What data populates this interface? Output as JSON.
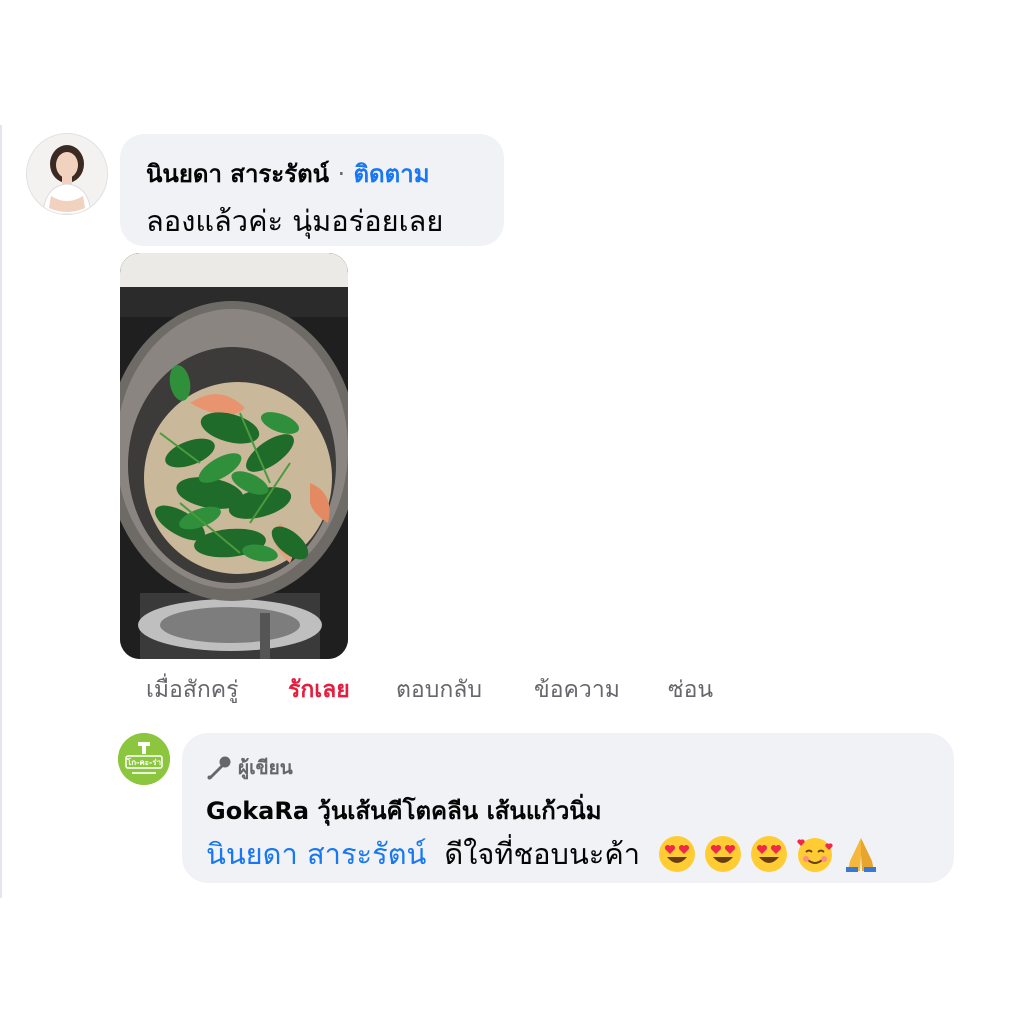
{
  "comment1": {
    "author": "นินยดา สาระรัตน์",
    "separator": "·",
    "follow_label": "ติดตาม",
    "text": "ลองแล้วค่ะ นุ่มอร่อยเลย",
    "timestamp": "เมื่อสักครู่",
    "actions": {
      "love": "รักเลย",
      "reply": "ตอบกลับ",
      "message": "ข้อความ",
      "hide": "ซ่อน"
    }
  },
  "comment2": {
    "badge": "ผู้เขียน",
    "author": "GokaRa วุ้นเส้นคีโตคลีน เส้นแก้วนิ่ม",
    "mention": "นินยดา สาระรัตน์",
    "text": "ดีใจที่ชอบนะค้า",
    "emoji_icons": [
      "heart-eyes-icon",
      "heart-eyes-icon",
      "heart-eyes-icon",
      "smiling-face-with-hearts-icon",
      "folded-hands-icon"
    ],
    "avatar_text": "โก-คะ-ร่า"
  },
  "colors": {
    "bubble": "#f0f2f5",
    "link": "#1877f2",
    "love": "#e41e3f",
    "muted": "#65676b",
    "brand_green": "#8cc63f"
  }
}
